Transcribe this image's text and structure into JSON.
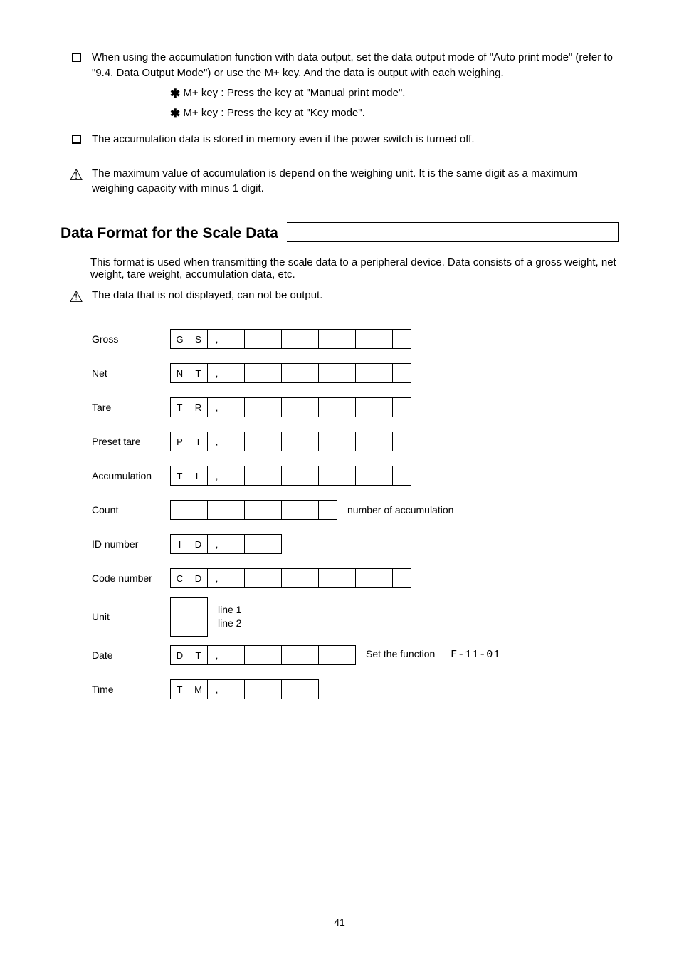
{
  "notes": {
    "b1": "When using the accumulation function with data output, set the data output mode of \"Auto print mode\" (refer to \"9.4. Data Output Mode\") or use the M+ key. And the data is output with each weighing.",
    "a1a": "M+ key : Press the key at \"Manual print mode\".",
    "a1b": "M+ key : Press the key at \"Key mode\".",
    "b2": "The accumulation data is stored in memory even if the power switch is turned off.",
    "warn": "The maximum value of accumulation is depend on the weighing unit. It is the same digit as a maximum weighing capacity with minus 1 digit.",
    "sectionTitle": "Data Format for the Scale Data",
    "intro": "This format is used when transmitting the scale data to a peripheral device. Data consists of a gross weight, net weight, tare weight, accumulation data, etc.",
    "hint": "The data that is not displayed, can not be output."
  },
  "rows": [
    {
      "label": "Gross",
      "prefix": "G",
      "cells": [
        "G",
        "S",
        ",",
        "",
        "",
        "",
        "",
        "",
        "",
        "",
        "",
        "",
        ""
      ],
      "after": ""
    },
    {
      "label": "Net",
      "prefix": "N",
      "cells": [
        "N",
        "T",
        ",",
        "",
        "",
        "",
        "",
        "",
        "",
        "",
        "",
        "",
        ""
      ],
      "after": ""
    },
    {
      "label": "Tare",
      "prefix": "T",
      "cells": [
        "T",
        "R",
        ",",
        "",
        "",
        "",
        "",
        "",
        "",
        "",
        "",
        "",
        ""
      ],
      "after": ""
    },
    {
      "label": "Preset tare",
      "cells": [
        "P",
        "T",
        ",",
        "",
        "",
        "",
        "",
        "",
        "",
        "",
        "",
        "",
        ""
      ],
      "after": ""
    },
    {
      "label": "Accumulation",
      "cells": [
        "T",
        "L",
        ",",
        "",
        "",
        "",
        "",
        "",
        "",
        "",
        "",
        "",
        ""
      ],
      "after": ""
    },
    {
      "label": "Count",
      "cells": [
        "",
        "",
        "",
        "",
        "",
        "",
        "",
        "",
        ""
      ],
      "after": "number of accumulation"
    },
    {
      "label": "ID number",
      "cells": [
        "I",
        "D",
        ",",
        "",
        "",
        ""
      ],
      "after": ""
    },
    {
      "label": "Code number",
      "cells": [
        "C",
        "D",
        ",",
        "",
        "",
        "",
        "",
        "",
        "",
        "",
        "",
        "",
        ""
      ],
      "after": ""
    }
  ],
  "unit": {
    "label": "Unit",
    "top": [
      "",
      ""
    ],
    "bottom": [
      "",
      ""
    ],
    "after_top": "line 1",
    "after_bottom": "line 2"
  },
  "date": {
    "label": "Date",
    "cells": [
      "D",
      "T",
      ",",
      "",
      "",
      "",
      "",
      "",
      "",
      ""
    ],
    "seg": "F-11-01",
    "after": "Set the function"
  },
  "time": {
    "label": "Time",
    "cells": [
      "T",
      "M",
      ",",
      "",
      "",
      "",
      "",
      ""
    ],
    "after": ""
  },
  "page": "41"
}
